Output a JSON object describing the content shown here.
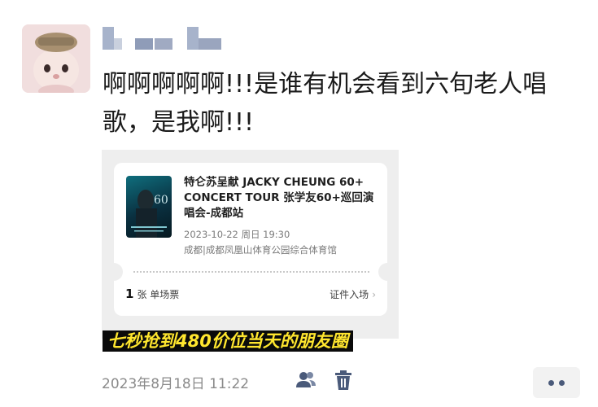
{
  "post": {
    "text": "啊啊啊啊啊!!!是谁有机会看到六旬老人唱歌，是我啊!!!",
    "timestamp": "2023年8月18日 11:22"
  },
  "ticket": {
    "title": "特仑苏呈献 JACKY CHEUNG 60+ CONCERT TOUR 张学友60+巡回演唱会-成都站",
    "datetime": "2023-10-22 周日 19:30",
    "venue": "成都|成都凤凰山体育公园综合体育馆",
    "count": "1",
    "count_label": "张 单场票",
    "entry_label": "证件入场",
    "entry_chevron": "›"
  },
  "caption": "七秒抢到480价位当天的朋友圈",
  "icons": {
    "avatar": "plush-bunny-avatar",
    "privacy": "people-icon",
    "delete": "trash-icon",
    "more": "more-dots-icon"
  },
  "colors": {
    "caption_text": "#ffe62e",
    "caption_bg": "#0a0a0a",
    "action_icon": "#4a5a7a"
  }
}
